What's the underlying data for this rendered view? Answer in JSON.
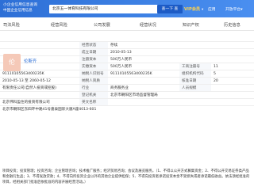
{
  "header": {
    "logo_line1": "小企业信用信息查询",
    "logo_line2": "中国企业信用信息",
    "search_value": "北京五一体育科技有限公司",
    "search_button": "查一下 查",
    "vip_label": "VIP会员",
    "vip_sub": "▾",
    "link_app": "应用",
    "link_more": "开放平台▾"
  },
  "tabs": [
    {
      "label": "司法风险",
      "badge": ""
    },
    {
      "label": "经营风险",
      "badge": ""
    },
    {
      "label": "公司发展",
      "badge": ""
    },
    {
      "label": "经营状况",
      "badge": ""
    },
    {
      "label": "知识产权",
      "badge": ""
    },
    {
      "label": "历史信息",
      "badge": ""
    }
  ],
  "company": {
    "logo_text": "伦",
    "name": "伦斯齐"
  },
  "info": {
    "r1": {
      "l1": "",
      "v1": "",
      "l2": "经营状态",
      "v2": "存续"
    },
    "r2": {
      "l2": "成立日期",
      "v2": "2010-05-13"
    },
    "r3": {
      "l2": "注册资本",
      "v2": "500万人民币"
    },
    "r4": {
      "l2": "实缴资本",
      "v2": "500万人民币",
      "l3": "工商注册号",
      "v3": "11"
    },
    "r5": {
      "v1": "91110105563400235K",
      "l2": "纳税人识别号",
      "v2": "91110105563400235K",
      "l3": "组织机构代码",
      "v3": "5"
    },
    "r6": {
      "v1": "2010-05-13 至 2060-05-12",
      "l2": "纳税人资质",
      "v2": "",
      "l3": "核准日期",
      "v3": "20"
    },
    "r7": {
      "v1": "有限责任公司(自然人投资或控股)",
      "l2": "行业",
      "v2": "商务服务业",
      "l3": "人员规模",
      "v3": ""
    },
    "r8": {
      "v1": "",
      "l2": "登记机关",
      "v2": "北京市朝阳区市场监督管理局"
    },
    "r9": {
      "v1": "北京伟科盈住的投资有限公司",
      "l2": "英文名称",
      "v2": ""
    },
    "r10": {
      "v1": "北京市朝阳区东四环中路41号嘉泰国际大厦A座4013-601"
    }
  },
  "scope_text": "项目投资；投资管理；投资咨询；企业管理咨询；技术推广服务；经济贸易咨询；会议及展览服务。（1、不得以公开方式募集资金；2、不得公开交易证券类产品和金融衍生品；3、不得发放贷款；4、不得向所投资企业以外的其他企业提供担保；5、不得向投资者承诺投资本金不受损失或者承诺最低收益。依法须经批准的项目，经相关部门批准后依批准的内容开展经营活动。）"
}
